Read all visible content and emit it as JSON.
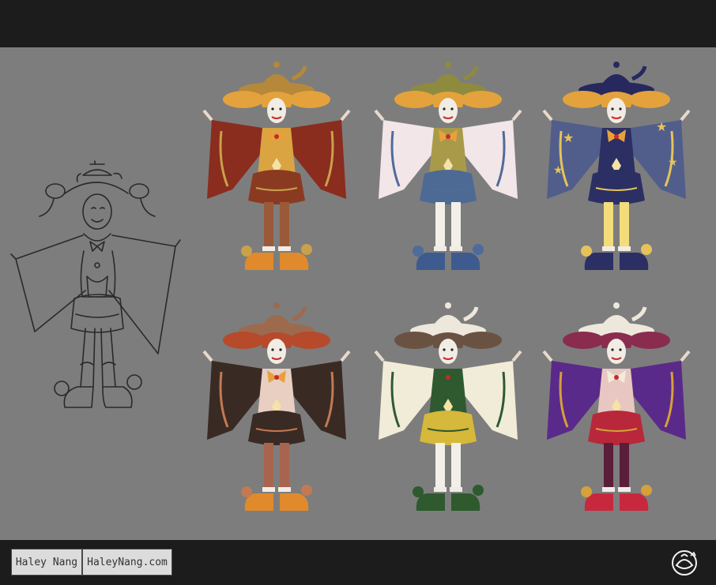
{
  "credits": {
    "author_name": "Haley Nang",
    "website": "HaleyNang.com"
  },
  "logo": {
    "icon": "teapot-monogram-logo"
  },
  "canvas": {
    "background": "#7d7d7d"
  },
  "sketch": {
    "line_color": "#2a2a2a"
  },
  "variants": [
    {
      "id": "orange-red",
      "hat": "#b5883a",
      "hair": "#e3a23c",
      "sleeve": "#8a2c1e",
      "sleeve_lining": "#c8a24a",
      "body": "#d9a441",
      "shorts": "#8b3a22",
      "legs": "#9a5a3a",
      "shoes": "#e08a2c",
      "bow": "#e8a13a"
    },
    {
      "id": "olive-blue",
      "hat": "#8e8a3e",
      "hair": "#e3a23c",
      "sleeve": "#f2e6e8",
      "sleeve_lining": "#4f6b9a",
      "body": "#a99a4a",
      "shorts": "#4d6a95",
      "legs": "#f1efe8",
      "shoes": "#3e5b8f",
      "bow": "#e8a13a"
    },
    {
      "id": "navy-stars",
      "hat": "#26285e",
      "hair": "#e3a23c",
      "sleeve": "#515e8c",
      "sleeve_lining": "#e6c35a",
      "body": "#2b2f63",
      "shorts": "#2b2f63",
      "legs": "#f3dc7a",
      "shoes": "#2b2f63",
      "bow": "#e8a13a"
    },
    {
      "id": "brown-black",
      "hat": "#9d6a4e",
      "hair": "#b64a2a",
      "sleeve": "#3a2a24",
      "sleeve_lining": "#c27a52",
      "body": "#e8cfc2",
      "shorts": "#3a2a24",
      "legs": "#a96450",
      "shoes": "#e08a2c",
      "bow": "#e8a13a"
    },
    {
      "id": "white-green",
      "hat": "#eee8dc",
      "hair": "#6a5243",
      "sleeve": "#f1ecd8",
      "sleeve_lining": "#2e5a2e",
      "body": "#2f5a2f",
      "shorts": "#d6b83a",
      "legs": "#f1efe8",
      "shoes": "#2e5a2e",
      "bow": "#2e5a2e"
    },
    {
      "id": "purple-red",
      "hat": "#eee8dc",
      "hair": "#8a2c4e",
      "sleeve": "#5a2a8a",
      "sleeve_lining": "#d6a03a",
      "body": "#e8c7c2",
      "shorts": "#b8283a",
      "legs": "#5a1e3a",
      "shoes": "#c8283e",
      "bow": "#f1ecd8"
    }
  ]
}
